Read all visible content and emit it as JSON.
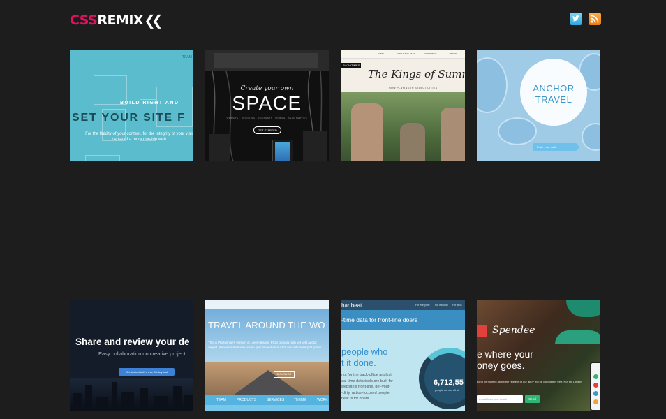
{
  "header": {
    "logo": {
      "css": "CSS",
      "remix": "REMIX",
      "chevrons": "❮❮"
    },
    "social": [
      {
        "name": "twitter",
        "icon": "twitter-icon"
      },
      {
        "name": "rss",
        "icon": "rss-icon"
      }
    ]
  },
  "colors": {
    "background": "#1d1d1e",
    "logo_accent": "#e0115f"
  },
  "tiles": [
    {
      "corner_label": "TEAM",
      "kicker": "BUILD RIGHT AND",
      "headline": "SET YOUR SITE F",
      "body": "For the fluidity of your content, for the integrity of your visio cause of a more durable web."
    },
    {
      "intro": "Create your own",
      "headline": "SPACE",
      "nav": "WEBSITE · BRANDING · CONTENTS · MOBILE · SELF SERVICE",
      "button": "GET STARTED"
    },
    {
      "nav": [
        "HOME",
        "ABOUT THE FILM",
        "SHOWTIMES",
        "PRESS"
      ],
      "tag": "SHOWTIMES",
      "title": "The Kings of Summer",
      "subtitle": "NOW PLAYING IN SELECT CITIES"
    },
    {
      "title_line1": "ANCHOR",
      "title_line2": "TRAVEL",
      "bottle_text": "Enter your mail"
    },
    {
      "headline": "Share and review your de",
      "subline": "Easy collaboration on creative project",
      "button": "Get started with a free 30-day trial"
    },
    {
      "headline": "TRAVEL AROUND THE WO",
      "body": "This is Photoshop's version of Lorem Ipsum. Proin gravida nibh vel velit auctor aliquet. Aenean sollicitudin, lorem quis bibendum auctor, nisi elit consequat ipsum.",
      "button": "DISCOVER",
      "menu": [
        "TEAM",
        "PRODUCTS",
        "SERVICES",
        "THEME",
        "WORK"
      ]
    },
    {
      "brand": "hartbeat",
      "nav": [
        "For everyone",
        "For editorial",
        "For devs"
      ],
      "hero": "-time data for front-line doers",
      "headline_line1": "people who",
      "headline_line2": "t it done.",
      "body_lines": [
        "not for the back-office analyst.",
        "eal-time data tools are built for",
        "website's front-line, get-your-",
        "-dirty, action-focused people.",
        "beat is for doers."
      ],
      "counter": "6,712,55",
      "counter_label": "people across all si"
    },
    {
      "brand": "Spendee",
      "headline_line1": "e where your",
      "headline_line2": "oney goes.",
      "body": "ed to be notified about the release of our app? will be completely free. Not for 1 hour!",
      "input_placeholder": "e-mail from your email",
      "button": "Send"
    }
  ]
}
